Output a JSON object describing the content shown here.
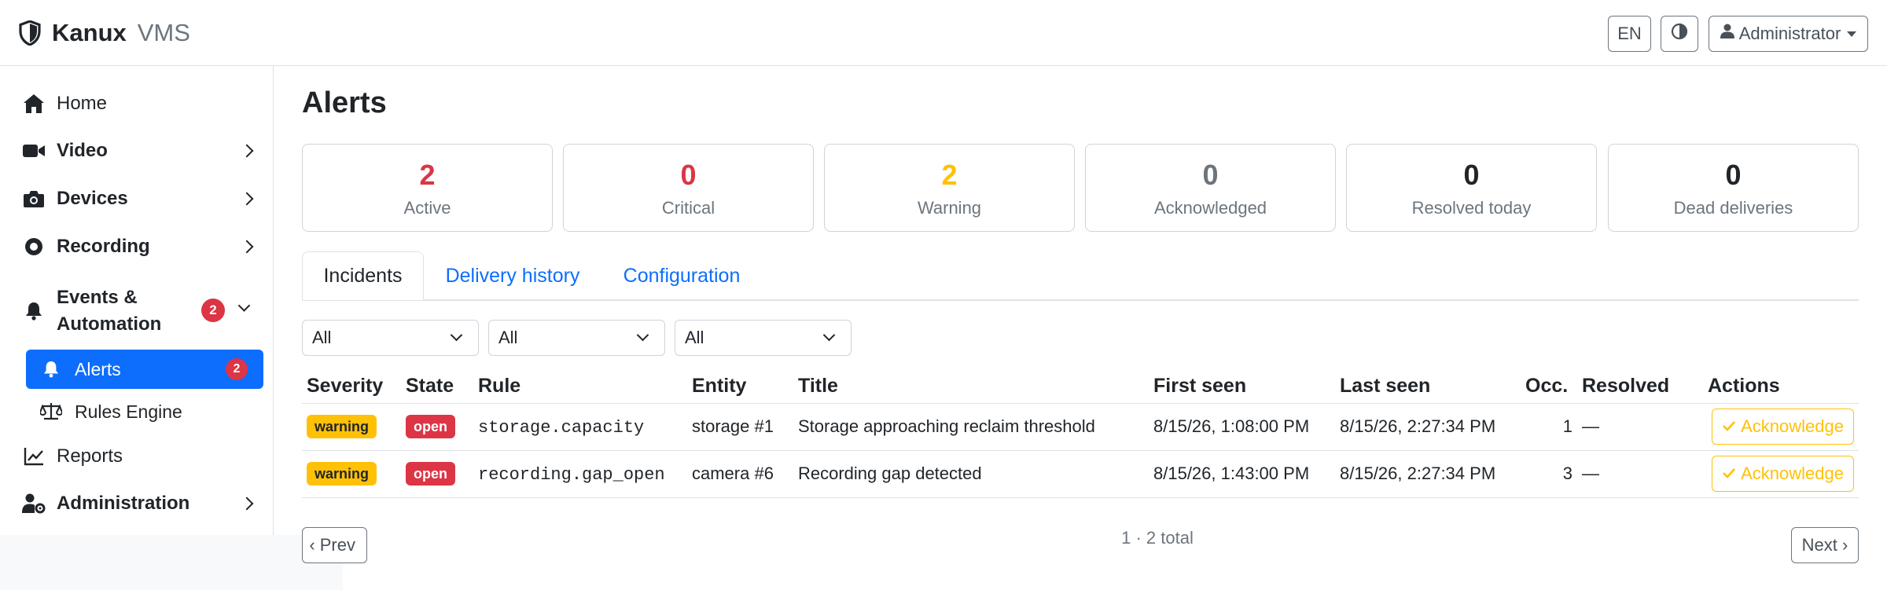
{
  "app": {
    "brand": "Kanux",
    "product": "VMS"
  },
  "topbar": {
    "language": "EN",
    "user": "Administrator"
  },
  "sidebar": {
    "items": [
      {
        "label": "Home",
        "icon": "home-icon"
      },
      {
        "label": "Video",
        "icon": "video-camera-icon"
      },
      {
        "label": "Devices",
        "icon": "camera-icon"
      },
      {
        "label": "Recording",
        "icon": "record-icon"
      },
      {
        "label": "Events & Automation",
        "icon": "bell-icon",
        "badge": "2"
      },
      {
        "label": "Reports",
        "icon": "chart-line-icon"
      },
      {
        "label": "Administration",
        "icon": "user-gear-icon"
      }
    ],
    "subitems": [
      {
        "label": "Alerts",
        "icon": "bell-icon",
        "badge": "2",
        "active": true
      },
      {
        "label": "Rules Engine",
        "icon": "scale-icon"
      }
    ]
  },
  "page": {
    "title": "Alerts"
  },
  "stats": [
    {
      "value": "2",
      "label": "Active",
      "color": "#dc3545"
    },
    {
      "value": "0",
      "label": "Critical",
      "color": "#dc3545"
    },
    {
      "value": "2",
      "label": "Warning",
      "color": "#ffc107"
    },
    {
      "value": "0",
      "label": "Acknowledged",
      "color": "#6c757d"
    },
    {
      "value": "0",
      "label": "Resolved today",
      "color": "#212529"
    },
    {
      "value": "0",
      "label": "Dead deliveries",
      "color": "#212529"
    }
  ],
  "tabs": [
    {
      "label": "Incidents",
      "active": true
    },
    {
      "label": "Delivery history"
    },
    {
      "label": "Configuration"
    }
  ],
  "filters": [
    "All",
    "All",
    "All"
  ],
  "table": {
    "headers": [
      "Severity",
      "State",
      "Rule",
      "Entity",
      "Title",
      "First seen",
      "Last seen",
      "Occ.",
      "Resolved",
      "Actions"
    ],
    "rows": [
      {
        "severity": "warning",
        "state": "open",
        "rule": "storage.capacity",
        "entity": "storage #1",
        "title": "Storage approaching reclaim threshold",
        "first_seen": "8/15/26, 1:08:00 PM",
        "last_seen": "8/15/26, 2:27:34 PM",
        "occ": "1",
        "resolved": "—",
        "action": "Acknowledge"
      },
      {
        "severity": "warning",
        "state": "open",
        "rule": "recording.gap_open",
        "entity": "camera #6",
        "title": "Recording gap detected",
        "first_seen": "8/15/26, 1:43:00 PM",
        "last_seen": "8/15/26, 2:27:34 PM",
        "occ": "3",
        "resolved": "—",
        "action": "Acknowledge"
      }
    ]
  },
  "pager": {
    "prev": "‹ Prev",
    "info": "1 · 2 total",
    "next": "Next ›"
  }
}
